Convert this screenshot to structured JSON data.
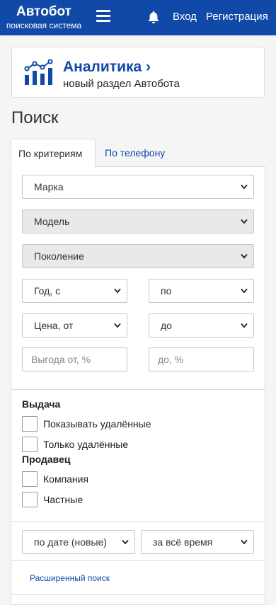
{
  "header": {
    "logo_title": "Автобот",
    "logo_subtitle": "поисковая система",
    "menu_icon": "hamburger-menu-icon",
    "bell_icon": "bell-icon",
    "login": "Вход",
    "register": "Регистрация"
  },
  "analytics": {
    "icon": "analytics-chart-icon",
    "title": "Аналитика ›",
    "subtitle": "новый раздел Автобота"
  },
  "page_title": "Поиск",
  "tabs": [
    {
      "label": "По критериям",
      "active": true
    },
    {
      "label": "По телефону",
      "active": false
    }
  ],
  "filters": {
    "brand": "Марка",
    "model": "Модель",
    "generation": "Поколение",
    "year_from": "Год, с",
    "year_to": "по",
    "price_from": "Цена, от",
    "price_to": "до",
    "benefit_from_placeholder": "Выгода от, %",
    "benefit_to_placeholder": "до, %"
  },
  "output": {
    "heading": "Выдача",
    "show_deleted": "Показывать удалённые",
    "only_deleted": "Только удалённые"
  },
  "seller": {
    "heading": "Продавец",
    "company": "Компания",
    "private": "Частные"
  },
  "sorting": {
    "sort": "по дате (новые)",
    "period": "за всё время"
  },
  "advanced_search": "Расширенный поиск",
  "colors": {
    "brand_blue": "#1049a8",
    "disabled_field": "#e9e9e9"
  }
}
